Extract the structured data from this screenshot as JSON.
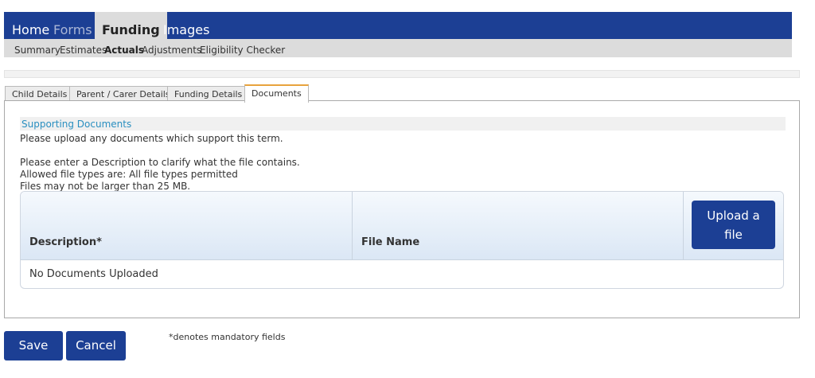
{
  "topnav": {
    "home": "Home",
    "forms": "Forms",
    "funding": "Funding",
    "images": "Images"
  },
  "subnav": {
    "summary": "Summary",
    "estimates": "Estimates",
    "actuals": "Actuals",
    "adjustments": "Adjustments",
    "eligibility": "Eligibility Checker"
  },
  "tabs": {
    "child": "Child Details",
    "parent": "Parent / Carer Details",
    "funding": "Funding Details",
    "documents": "Documents"
  },
  "section": {
    "title": "Supporting Documents",
    "line1": "Please upload any documents which support this term.",
    "line2": "Please enter a Description to clarify what the file contains.",
    "line3": "Allowed file types are: All file types permitted",
    "line4": "Files may not be larger than 25 MB."
  },
  "table": {
    "col_description": "Description*",
    "col_filename": "File Name",
    "upload_label": "Upload a file",
    "empty_text": "No Documents Uploaded"
  },
  "footer": {
    "save": "Save",
    "cancel": "Cancel",
    "note": "*denotes mandatory fields"
  },
  "colors": {
    "primary": "#1c3f94",
    "active_tab_accent": "#e8a33d",
    "section_title": "#2a8fc0"
  }
}
